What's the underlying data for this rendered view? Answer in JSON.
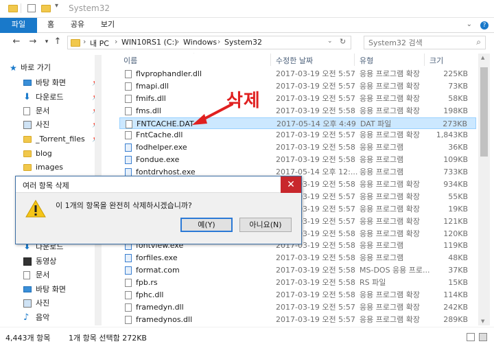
{
  "window": {
    "title": "System32",
    "quick_access_icons": [
      "folder-icon",
      "properties-icon",
      "new-folder-icon",
      "customize-icon"
    ]
  },
  "ribbon": {
    "tabs": [
      {
        "label": "파일",
        "active": true
      },
      {
        "label": "홈"
      },
      {
        "label": "공유"
      },
      {
        "label": "보기"
      }
    ],
    "help_glyph": "?"
  },
  "address": {
    "segments": [
      "내 PC",
      "WIN10RS1 (C:)",
      "Windows",
      "System32"
    ],
    "search_placeholder": "System32 검색"
  },
  "sidebar": {
    "items": [
      {
        "label": "바로 가기",
        "icon": "star-icon"
      },
      {
        "label": "바탕 화면",
        "icon": "desktop-icon",
        "pinned": true
      },
      {
        "label": "다운로드",
        "icon": "download-icon",
        "pinned": true
      },
      {
        "label": "문서",
        "icon": "documents-icon",
        "pinned": true
      },
      {
        "label": "사진",
        "icon": "pictures-icon",
        "pinned": true
      },
      {
        "label": "_Torrent_files",
        "icon": "folder-icon",
        "pinned": true
      },
      {
        "label": "blog",
        "icon": "folder-icon"
      },
      {
        "label": "images",
        "icon": "folder-icon"
      },
      {
        "label": "다운로드",
        "icon": "download-icon"
      },
      {
        "label": "동영상",
        "icon": "videos-icon"
      },
      {
        "label": "문서",
        "icon": "documents-icon"
      },
      {
        "label": "바탕 화면",
        "icon": "desktop-icon"
      },
      {
        "label": "사진",
        "icon": "pictures-icon"
      },
      {
        "label": "음악",
        "icon": "music-icon"
      }
    ]
  },
  "columns": {
    "name": "이름",
    "date": "수정한 날짜",
    "type": "유형",
    "size": "크기"
  },
  "files": [
    {
      "name": "flvprophandler.dll",
      "date": "2017-03-19 오전 5:57",
      "type": "응용 프로그램 확장",
      "size": "225KB",
      "kind": "dll"
    },
    {
      "name": "fmapi.dll",
      "date": "2017-03-19 오전 5:57",
      "type": "응용 프로그램 확장",
      "size": "73KB",
      "kind": "dll"
    },
    {
      "name": "fmifs.dll",
      "date": "2017-03-19 오전 5:57",
      "type": "응용 프로그램 확장",
      "size": "58KB",
      "kind": "dll"
    },
    {
      "name": "fms.dll",
      "date": "2017-03-19 오전 5:58",
      "type": "응용 프로그램 확장",
      "size": "198KB",
      "kind": "dll"
    },
    {
      "name": "FNTCACHE.DAT",
      "date": "2017-05-14 오후 4:49",
      "type": "DAT 파일",
      "size": "273KB",
      "kind": "dat",
      "selected": true
    },
    {
      "name": "FntCache.dll",
      "date": "2017-03-19 오전 5:57",
      "type": "응용 프로그램 확장",
      "size": "1,843KB",
      "kind": "dll"
    },
    {
      "name": "fodhelper.exe",
      "date": "2017-03-19 오전 5:58",
      "type": "응용 프로그램",
      "size": "36KB",
      "kind": "exe"
    },
    {
      "name": "Fondue.exe",
      "date": "2017-03-19 오전 5:58",
      "type": "응용 프로그램",
      "size": "109KB",
      "kind": "exe"
    },
    {
      "name": "fontdrvhost.exe",
      "date": "2017-05-14 오후 12:...",
      "type": "응용 프로그램",
      "size": "733KB",
      "kind": "exe"
    },
    {
      "name": "",
      "date": "2017-03-19 오전 5:58",
      "type": "응용 프로그램 확장",
      "size": "934KB",
      "kind": "dll"
    },
    {
      "name": "",
      "date": "2017-03-19 오전 5:57",
      "type": "응용 프로그램 확장",
      "size": "55KB",
      "kind": "dll"
    },
    {
      "name": "",
      "date": "2017-03-19 오전 5:57",
      "type": "응용 프로그램 확장",
      "size": "19KB",
      "kind": "dll"
    },
    {
      "name": "",
      "date": "2017-03-19 오전 5:57",
      "type": "응용 프로그램 확장",
      "size": "121KB",
      "kind": "dll"
    },
    {
      "name": "",
      "date": "2017-03-19 오전 5:58",
      "type": "응용 프로그램 확장",
      "size": "120KB",
      "kind": "dll"
    },
    {
      "name": "fontview.exe",
      "date": "2017-03-19 오전 5:58",
      "type": "응용 프로그램",
      "size": "119KB",
      "kind": "exe"
    },
    {
      "name": "forfiles.exe",
      "date": "2017-03-19 오전 5:58",
      "type": "응용 프로그램",
      "size": "48KB",
      "kind": "exe"
    },
    {
      "name": "format.com",
      "date": "2017-03-19 오전 5:58",
      "type": "MS-DOS 응용 프로...",
      "size": "37KB",
      "kind": "exe"
    },
    {
      "name": "fpb.rs",
      "date": "2017-03-19 오전 5:58",
      "type": "RS 파일",
      "size": "15KB",
      "kind": "dat"
    },
    {
      "name": "fphc.dll",
      "date": "2017-03-19 오전 5:58",
      "type": "응용 프로그램 확장",
      "size": "114KB",
      "kind": "dll"
    },
    {
      "name": "framedyn.dll",
      "date": "2017-03-19 오전 5:57",
      "type": "응용 프로그램 확장",
      "size": "242KB",
      "kind": "dll"
    },
    {
      "name": "framedynos.dll",
      "date": "2017-03-19 오전 5:57",
      "type": "응용 프로그램 확장",
      "size": "289KB",
      "kind": "dll"
    }
  ],
  "annotation": {
    "label": "삭제",
    "color": "#e02020"
  },
  "dialog": {
    "title": "여러 항목 삭제",
    "message": "이 1개의 항목을 완전히 삭제하시겠습니까?",
    "yes_label": "예(Y)",
    "no_label": "아니요(N)",
    "close_glyph": "✕"
  },
  "status": {
    "count": "4,443개 항목",
    "selection": "1개 항목 선택함 272KB"
  },
  "colors": {
    "accent": "#1979ca",
    "selection": "#cce8ff",
    "close": "#c8272c"
  }
}
